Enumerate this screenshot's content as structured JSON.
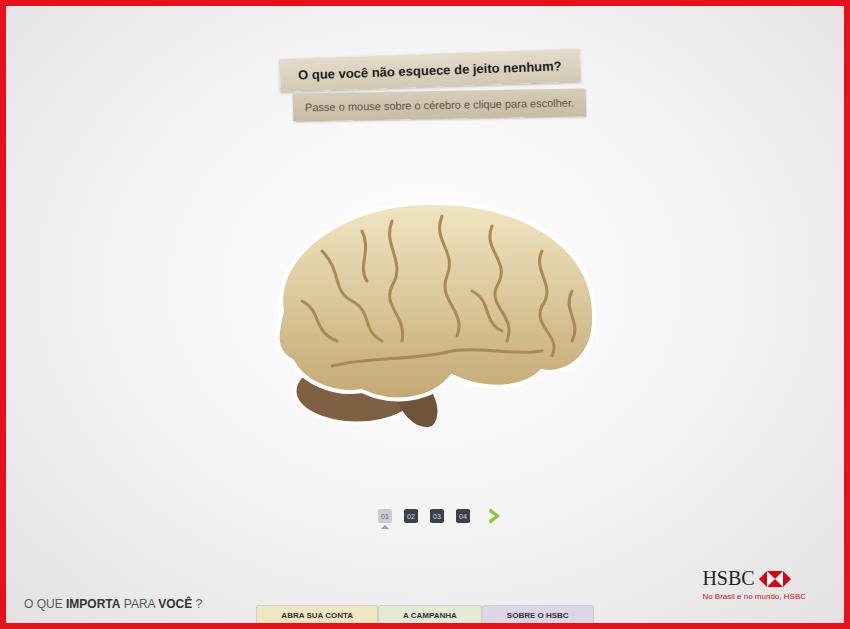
{
  "question": {
    "title": "O que você não esquece de jeito nenhum?",
    "hint": "Passe o mouse sobre o cérebro e clique para escolher."
  },
  "pager": {
    "pages": [
      {
        "label": "01",
        "selected": true
      },
      {
        "label": "02",
        "selected": false
      },
      {
        "label": "03",
        "selected": false
      },
      {
        "label": "04",
        "selected": false
      }
    ]
  },
  "tagline": [
    {
      "text": "O QUE ",
      "bold": false
    },
    {
      "text": "IMPORTA",
      "bold": true
    },
    {
      "text": " PARA ",
      "bold": false
    },
    {
      "text": "VOCÊ",
      "bold": true
    },
    {
      "text": " ?",
      "bold": false
    }
  ],
  "brand": {
    "name": "HSBC",
    "slogan": "No Brasil e no mundo, HSBC"
  },
  "tabs": [
    {
      "label": "ABRA SUA CONTA",
      "color": "#efe6c2"
    },
    {
      "label": "A CAMPANHA",
      "color": "#e2ead4"
    },
    {
      "label": "SOBRE O HSBC",
      "color": "#dcd6e6"
    }
  ]
}
